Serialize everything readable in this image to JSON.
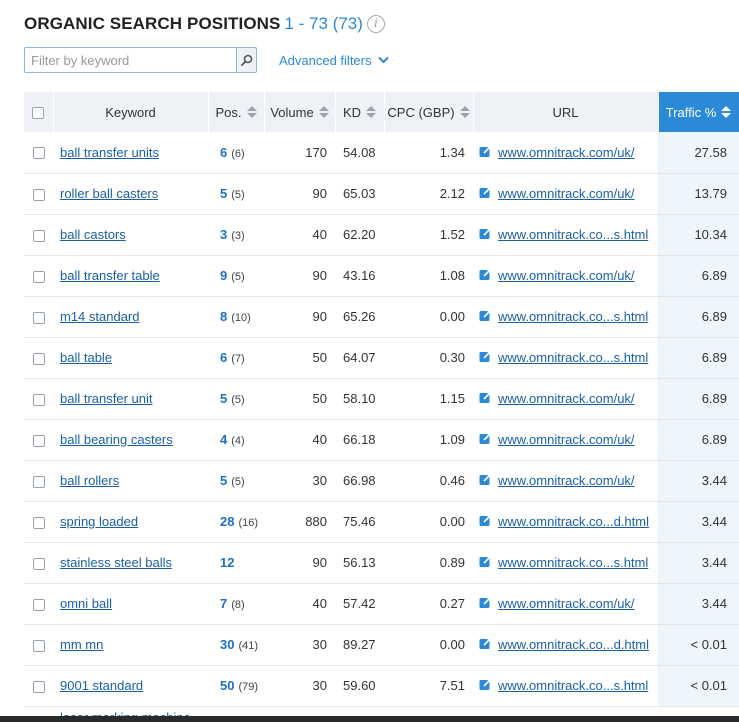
{
  "header": {
    "title": "ORGANIC SEARCH POSITIONS",
    "range": "1 - 73 (73)",
    "info_icon": "info-icon"
  },
  "filter": {
    "placeholder": "Filter by keyword",
    "search_icon": "search-icon",
    "advanced_label": "Advanced filters",
    "advanced_icon": "chevron-down-icon"
  },
  "table": {
    "columns": {
      "keyword": "Keyword",
      "pos": "Pos.",
      "volume": "Volume",
      "kd": "KD",
      "cpc": "CPC (GBP)",
      "url": "URL",
      "traffic": "Traffic %"
    },
    "sorted_column": "traffic",
    "accent_color": "#2b8ad8",
    "rows": [
      {
        "keyword": "ball transfer units",
        "pos": "6",
        "prev": "(6)",
        "volume": "170",
        "kd": "54.08",
        "cpc": "1.34",
        "url": "www.omnitrack.com/uk/",
        "traffic": "27.58"
      },
      {
        "keyword": "roller ball casters",
        "pos": "5",
        "prev": "(5)",
        "volume": "90",
        "kd": "65.03",
        "cpc": "2.12",
        "url": "www.omnitrack.com/uk/",
        "traffic": "13.79"
      },
      {
        "keyword": "ball castors",
        "pos": "3",
        "prev": "(3)",
        "volume": "40",
        "kd": "62.20",
        "cpc": "1.52",
        "url": "www.omnitrack.co...s.html",
        "traffic": "10.34"
      },
      {
        "keyword": "ball transfer table",
        "pos": "9",
        "prev": "(5)",
        "volume": "90",
        "kd": "43.16",
        "cpc": "1.08",
        "url": "www.omnitrack.com/uk/",
        "traffic": "6.89"
      },
      {
        "keyword": "m14 standard",
        "pos": "8",
        "prev": "(10)",
        "volume": "90",
        "kd": "65.26",
        "cpc": "0.00",
        "url": "www.omnitrack.co...s.html",
        "traffic": "6.89"
      },
      {
        "keyword": "ball table",
        "pos": "6",
        "prev": "(7)",
        "volume": "50",
        "kd": "64.07",
        "cpc": "0.30",
        "url": "www.omnitrack.co...s.html",
        "traffic": "6.89"
      },
      {
        "keyword": "ball transfer unit",
        "pos": "5",
        "prev": "(5)",
        "volume": "50",
        "kd": "58.10",
        "cpc": "1.15",
        "url": "www.omnitrack.com/uk/",
        "traffic": "6.89"
      },
      {
        "keyword": "ball bearing casters",
        "pos": "4",
        "prev": "(4)",
        "volume": "40",
        "kd": "66.18",
        "cpc": "1.09",
        "url": "www.omnitrack.com/uk/",
        "traffic": "6.89"
      },
      {
        "keyword": "ball rollers",
        "pos": "5",
        "prev": "(5)",
        "volume": "30",
        "kd": "66.98",
        "cpc": "0.46",
        "url": "www.omnitrack.com/uk/",
        "traffic": "3.44"
      },
      {
        "keyword": "spring loaded",
        "pos": "28",
        "prev": "(16)",
        "volume": "880",
        "kd": "75.46",
        "cpc": "0.00",
        "url": "www.omnitrack.co...d.html",
        "traffic": "3.44"
      },
      {
        "keyword": "stainless steel balls",
        "pos": "12",
        "prev": "",
        "volume": "90",
        "kd": "56.13",
        "cpc": "0.89",
        "url": "www.omnitrack.co...s.html",
        "traffic": "3.44"
      },
      {
        "keyword": "omni ball",
        "pos": "7",
        "prev": "(8)",
        "volume": "40",
        "kd": "57.42",
        "cpc": "0.27",
        "url": "www.omnitrack.com/uk/",
        "traffic": "3.44"
      },
      {
        "keyword": "mm mn",
        "pos": "30",
        "prev": "(41)",
        "volume": "30",
        "kd": "89.27",
        "cpc": "0.00",
        "url": "www.omnitrack.co...d.html",
        "traffic": "< 0.01"
      },
      {
        "keyword": "9001 standard",
        "pos": "50",
        "prev": "(79)",
        "volume": "30",
        "kd": "59.60",
        "cpc": "7.51",
        "url": "www.omnitrack.co...s.html",
        "traffic": "< 0.01"
      }
    ],
    "partial_row_keyword": "laser marking machine"
  }
}
